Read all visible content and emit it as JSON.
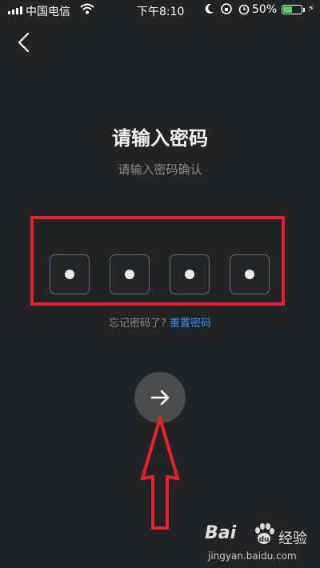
{
  "status_bar": {
    "carrier": "中国电信",
    "time": "下午8:10",
    "battery_percent": "50%",
    "battery_level": 0.5
  },
  "page": {
    "title": "请输入密码",
    "subtitle": "请输入密码确认"
  },
  "pin": {
    "filled": [
      true,
      true,
      true,
      true
    ]
  },
  "forgot": {
    "text": "忘记密码了?",
    "reset_link": "重置密码"
  },
  "icons": {
    "back": "chevron-left-icon",
    "next": "arrow-right-icon",
    "wifi": "wifi-icon",
    "moon": "moon-icon",
    "alarm": "alarm-icon"
  },
  "colors": {
    "background": "#222324",
    "highlight": "#e8212b",
    "link": "#3a8ee6",
    "battery": "#4cd964"
  },
  "watermark": {
    "brand": "Bai",
    "product": "经验",
    "url": "jingyan.baidu.com"
  }
}
